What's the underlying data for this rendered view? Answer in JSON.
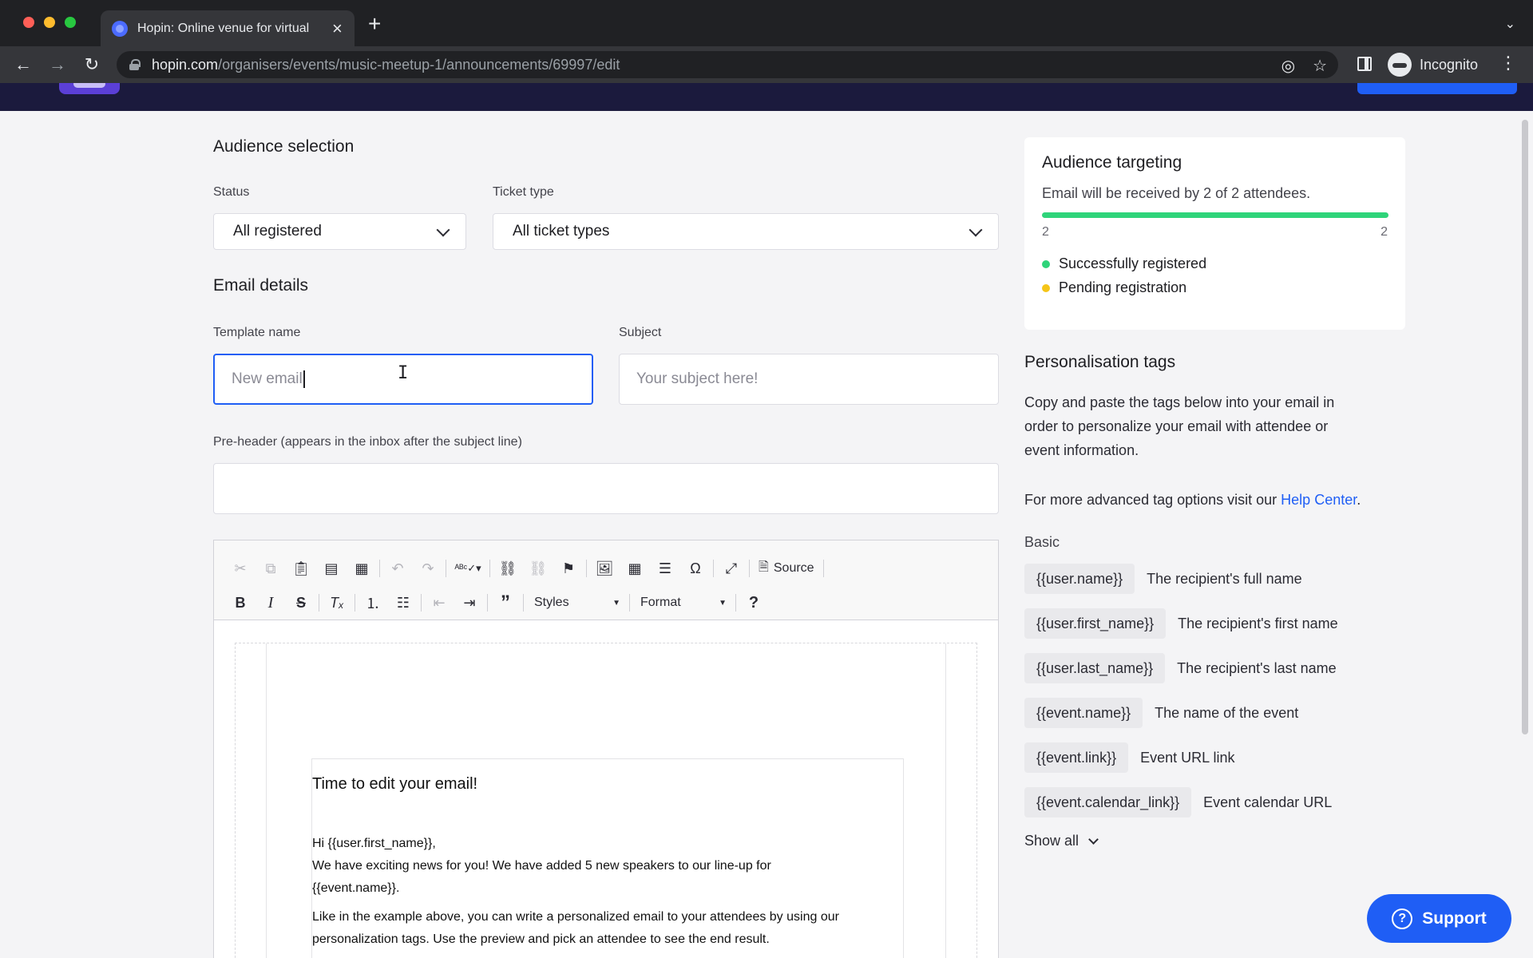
{
  "browser": {
    "tab_title": "Hopin: Online venue for virtual",
    "url_host": "hopin.com",
    "url_path": "/organisers/events/music-meetup-1/announcements/69997/edit",
    "profile_label": "Incognito"
  },
  "audience": {
    "title": "Audience selection",
    "status_label": "Status",
    "status_value": "All registered",
    "ticket_label": "Ticket type",
    "ticket_value": "All ticket types"
  },
  "email_details": {
    "title": "Email details",
    "template_label": "Template name",
    "template_placeholder": "New email",
    "subject_label": "Subject",
    "subject_placeholder": "Your subject here!",
    "preheader_label": "Pre-header (appears in the inbox after the subject line)",
    "preheader_value": ""
  },
  "editor": {
    "source_label": "Source",
    "styles_label": "Styles",
    "format_label": "Format",
    "content": {
      "heading": "Time to edit your email!",
      "greeting": "Hi {{user.first_name}},",
      "line1": "We have exciting news for you! We have added 5 new speakers to our line-up for",
      "line2": "{{event.name}}.",
      "line3": "Like in the example above, you can write a personalized email to your attendees by using our",
      "line4": "personalization tags. Use the preview and pick an attendee to see the end result."
    }
  },
  "targeting": {
    "title": "Audience targeting",
    "summary": "Email will be received by 2 of 2 attendees.",
    "received": 2,
    "total": 2,
    "min_label": "2",
    "max_label": "2",
    "legend": [
      {
        "label": "Successfully registered",
        "color": "#2fd47a"
      },
      {
        "label": "Pending registration",
        "color": "#f5c518"
      }
    ]
  },
  "personalisation": {
    "title": "Personalisation tags",
    "description1": "Copy and paste the tags below into your email in",
    "description2": "order to personalize your email with attendee or",
    "description3": "event information.",
    "help_prefix": "For more advanced tag options visit our ",
    "help_link": "Help Center",
    "help_suffix": ".",
    "basic_label": "Basic",
    "tags": [
      {
        "tag": "{{user.name}}",
        "desc": "The recipient's full name"
      },
      {
        "tag": "{{user.first_name}}",
        "desc": "The recipient's first name"
      },
      {
        "tag": "{{user.last_name}}",
        "desc": "The recipient's last name"
      },
      {
        "tag": "{{event.name}}",
        "desc": "The name of the event"
      },
      {
        "tag": "{{event.link}}",
        "desc": "Event URL link"
      },
      {
        "tag": "{{event.calendar_link}}",
        "desc": "Event calendar URL"
      }
    ],
    "show_all_label": "Show all"
  },
  "support_label": "Support",
  "colors": {
    "accent": "#1f5ef5",
    "header": "#1b1a3d",
    "success": "#2fd47a",
    "pending": "#f5c518"
  }
}
